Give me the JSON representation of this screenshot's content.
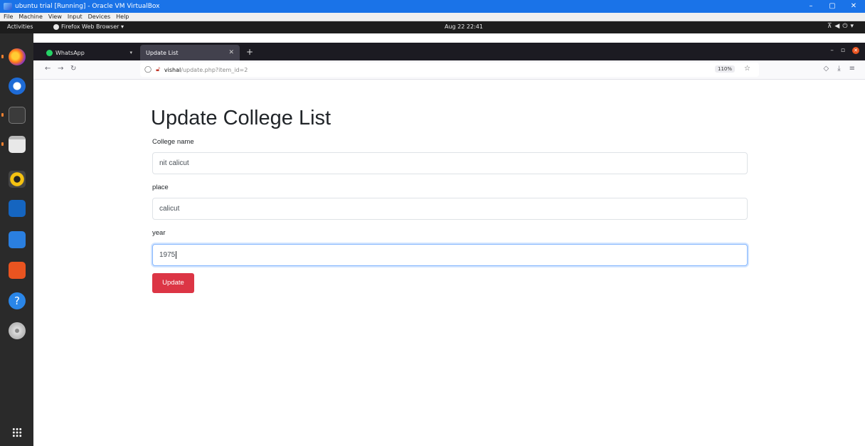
{
  "vbox": {
    "title": "ubuntu trial [Running] - Oracle VM VirtualBox",
    "menu": [
      "File",
      "Machine",
      "View",
      "Input",
      "Devices",
      "Help"
    ]
  },
  "gnome": {
    "activities": "Activities",
    "app_menu": "Firefox Web Browser ▾",
    "clock": "Aug 22  22:41"
  },
  "browser": {
    "tabs": [
      {
        "label": "WhatsApp"
      },
      {
        "label": "Update List"
      }
    ],
    "url": {
      "host": "vishal",
      "path": "/update.php?item_id=2",
      "zoom": "110%"
    }
  },
  "page": {
    "title": "Update College List",
    "fields": [
      {
        "label": "College name",
        "value": "nit calicut"
      },
      {
        "label": "place",
        "value": "calicut"
      },
      {
        "label": "year",
        "value": "1975"
      }
    ],
    "submit_label": "Update"
  },
  "colors": {
    "dock_bg": "#2a2a2a",
    "button_red": "#dc3545",
    "focus_blue": "#86b7fe"
  }
}
